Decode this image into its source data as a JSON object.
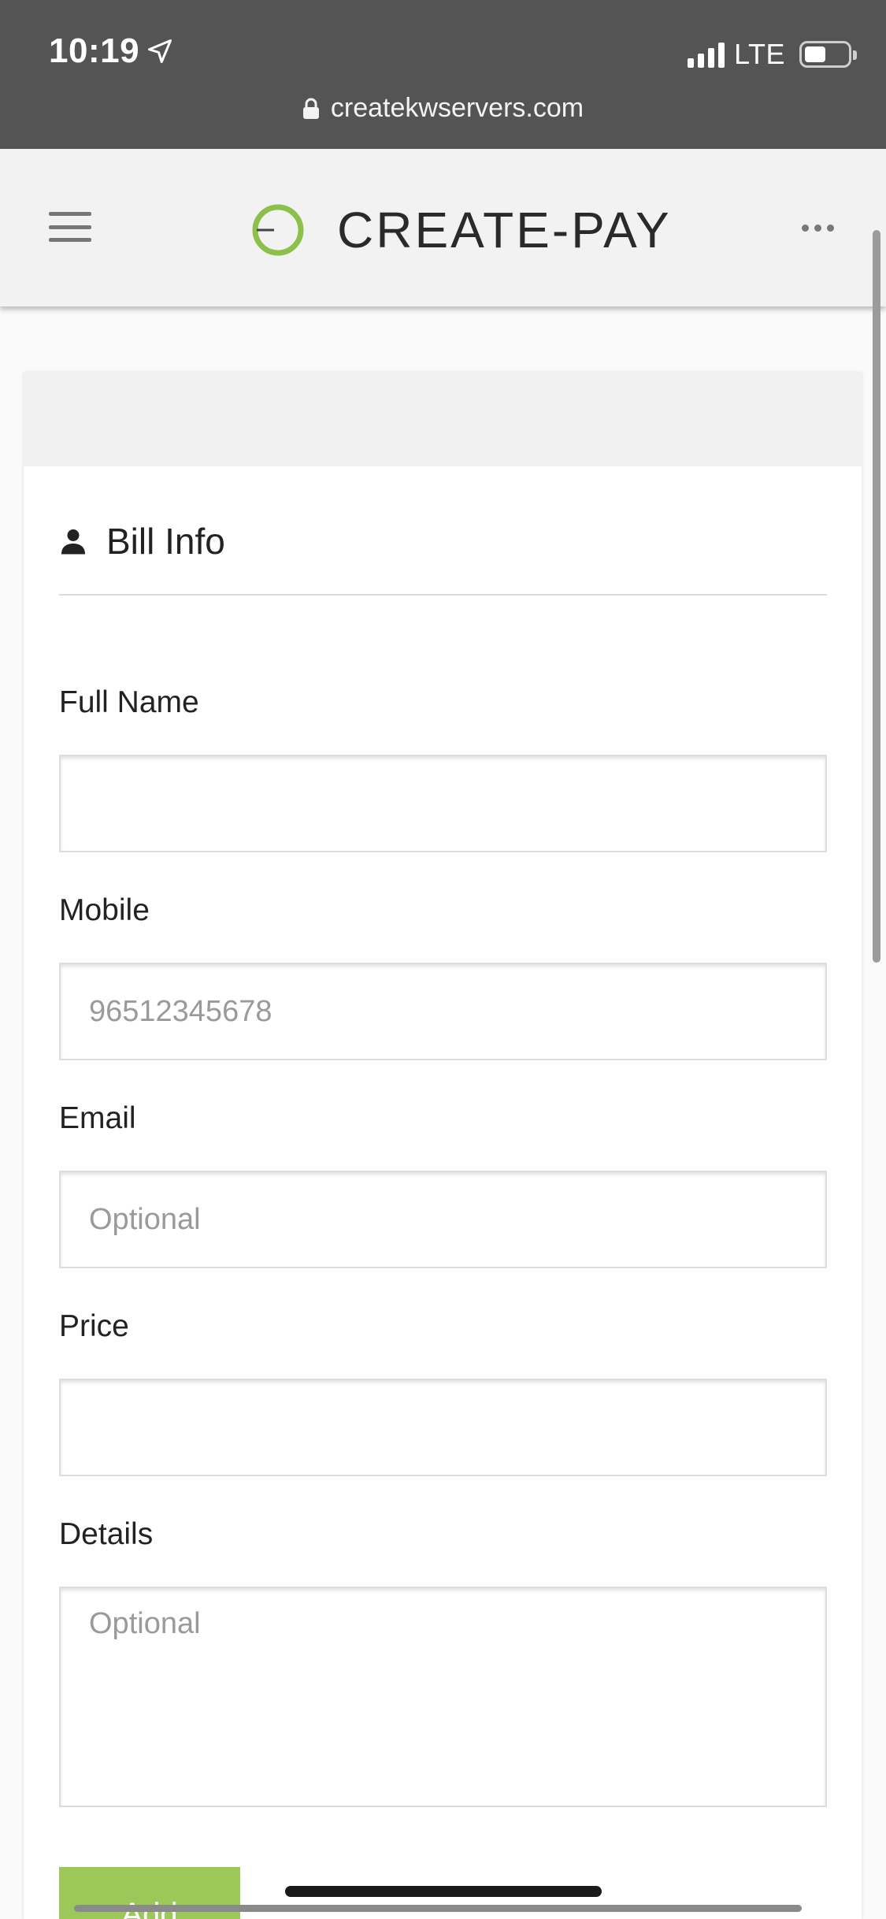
{
  "status_bar": {
    "time": "10:19",
    "network": "LTE",
    "url": "createkwservers.com"
  },
  "header": {
    "brand_name": "CREATE-PAY",
    "logo_color": "#8cc04b"
  },
  "section": {
    "title": "Bill Info"
  },
  "form": {
    "full_name": {
      "label": "Full Name",
      "value": "",
      "placeholder": ""
    },
    "mobile": {
      "label": "Mobile",
      "value": "",
      "placeholder": "96512345678"
    },
    "email": {
      "label": "Email",
      "value": "",
      "placeholder": "Optional"
    },
    "price": {
      "label": "Price",
      "value": "",
      "placeholder": ""
    },
    "details": {
      "label": "Details",
      "value": "",
      "placeholder": "Optional"
    },
    "add_button_label": "Add"
  },
  "icons": {
    "location": "location-arrow-icon",
    "lock": "lock-icon",
    "menu": "hamburger-menu-icon",
    "more": "more-horizontal-icon",
    "user": "user-icon"
  },
  "colors": {
    "status_bar": "#545454",
    "header": "#f2f2f2",
    "accent_button": "#9cc759"
  }
}
